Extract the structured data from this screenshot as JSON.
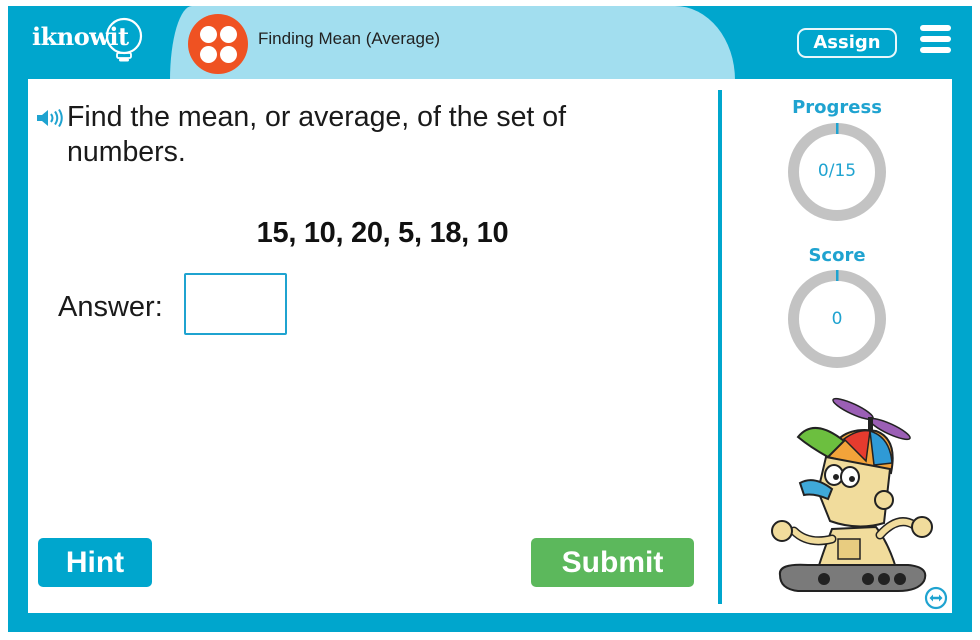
{
  "header": {
    "logo_text": "iknowit",
    "activity_title": "Finding Mean (Average)",
    "assign_label": "Assign",
    "menu_icon": "hamburger-menu-icon",
    "activity_icon": "four-dots-icon"
  },
  "question": {
    "sound_icon": "speaker-icon",
    "prompt": "Find the mean, or average, of the set of numbers.",
    "numbers": "15, 10, 20, 5, 18, 10",
    "answer_label": "Answer:",
    "answer_value": "",
    "answer_placeholder": ""
  },
  "buttons": {
    "hint_label": "Hint",
    "submit_label": "Submit"
  },
  "sidebar": {
    "progress_label": "Progress",
    "progress_value": "0/15",
    "progress_fraction": 0,
    "score_label": "Score",
    "score_value": "0",
    "score_fraction": 0,
    "mascot": "robot-with-propeller-cap",
    "expand_icon": "left-right-arrow-icon"
  },
  "colors": {
    "brand_blue": "#00a6cd",
    "tab_light_blue": "#a2deef",
    "activity_orange": "#ef5222",
    "submit_green": "#5cb85c",
    "ring_gray": "#c3c3c3",
    "accent_text": "#1fa3d0"
  }
}
